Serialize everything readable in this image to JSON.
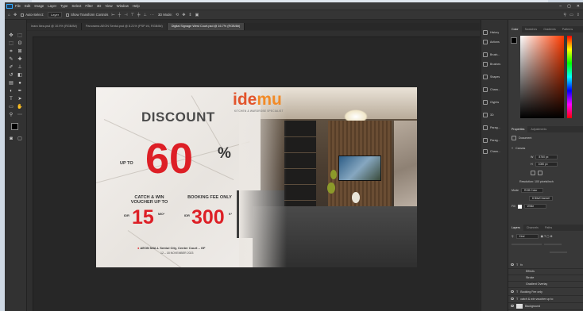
{
  "menubar": {
    "items": [
      "File",
      "Edit",
      "Image",
      "Layer",
      "Type",
      "Select",
      "Filter",
      "3D",
      "View",
      "Window",
      "Help"
    ],
    "window_controls": [
      "–",
      "▢",
      "✕"
    ]
  },
  "options": {
    "auto_select_label": "Auto-Select:",
    "auto_select_value": "Layer",
    "transform_label": "Show Transform Controls",
    "mode_label": "3D Mode:"
  },
  "tabs": [
    {
      "label": "Inara Ikea.psd @ 10.9% (RGB/8#)",
      "active": false
    },
    {
      "label": "Panorama AEON Sentul.psd @ 8.21% (PSP #4, RGB/8#)",
      "active": false
    },
    {
      "label": "Digital Signage West Court.psd @ 16.7% (RGB/8#)",
      "active": true
    }
  ],
  "artwork": {
    "brand_prefix": "ide",
    "brand_suffix": "mu",
    "brand_tagline": "KITCHEN & WARDROBE SPECIALIST",
    "headline": "DISCOUNT",
    "up_to": "UP TO",
    "discount_value": "60",
    "discount_unit": "%",
    "catch_label": "CATCH & WIN VOUCHER UP TO",
    "voucher_currency": "IDR",
    "voucher_value": "15",
    "voucher_unit": "MIO*",
    "booking_label": "BOOKING FEE ONLY",
    "fee_currency": "IDR",
    "fee_value": "300",
    "fee_unit": "K*",
    "venue": "AEON MALL Sentul City, Center Court – GF",
    "dates": "12 – 18 NOVEMBER 2023"
  },
  "dock": [
    "History",
    "Actions",
    "Brush...",
    "Brushes",
    "Shapes",
    "Chara...",
    "Glyphs",
    "3D",
    "Parag...",
    "Parag...",
    "Chara..."
  ],
  "color_panel": {
    "tabs": [
      "Color",
      "Swatches",
      "Gradients",
      "Patterns"
    ],
    "active_tab": "Color"
  },
  "properties": {
    "tabs": [
      "Properties",
      "Adjustments"
    ],
    "document_label": "Document",
    "canvas_section": "Canvas",
    "width": "8760 px",
    "height": "1080 px",
    "resolution": "Resolution: 100 pixels/inch",
    "mode_label": "Mode",
    "mode_value": "RGB Color",
    "depth_value": "8 Bits/Channel",
    "fill_label": "Fill",
    "fill_value": "White"
  },
  "layers": {
    "tabs": [
      "Layers",
      "Channels",
      "Paths"
    ],
    "kind_label": "Kind",
    "items": [
      {
        "name": "fx",
        "indent": false
      },
      {
        "name": "Effects",
        "indent": true
      },
      {
        "name": "Stroke",
        "indent": true
      },
      {
        "name": "Gradient Overlay",
        "indent": true
      },
      {
        "name": "Booking Fee only",
        "indent": false
      },
      {
        "name": "catch & win voucher up to",
        "indent": false
      },
      {
        "name": "Background",
        "indent": false
      }
    ]
  },
  "colors": {
    "accent_red": "#dd1f26",
    "brand_orange": "#e2542c",
    "ui_dark": "#2b2b2b"
  }
}
